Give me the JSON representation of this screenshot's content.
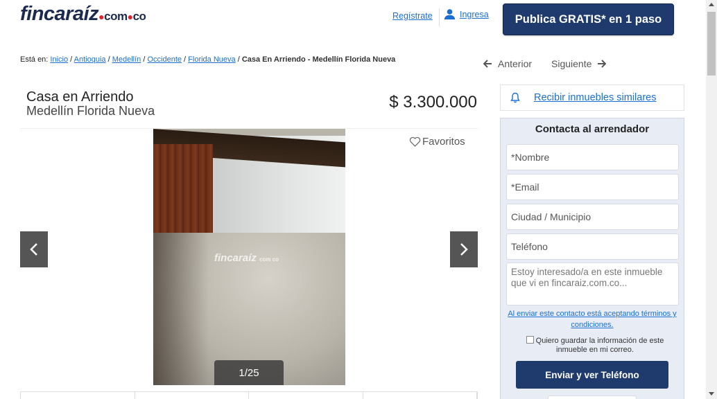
{
  "header": {
    "logo_main": "fincaraíz",
    "logo_suffix": "com",
    "logo_suffix2": "co",
    "register_label": "Regístrate",
    "login_label": "Ingresa",
    "publish_label": "Publica GRATIS* en 1 paso"
  },
  "breadcrumb": {
    "prefix": "Está en:",
    "items": [
      "Inicio",
      "Antioquia",
      "Medellín",
      "Occidente",
      "Florida Nueva"
    ],
    "current": "Casa En Arriendo - Medellín Florida Nueva"
  },
  "pager": {
    "prev_label": "Anterior",
    "next_label": "Siguiente"
  },
  "listing": {
    "title": "Casa en Arriendo",
    "location": "Medellín Florida Nueva",
    "price": "$ 3.300.000",
    "favorites_label": "Favoritos",
    "photo_counter": "1/25",
    "photo_watermark": "fincaraíz",
    "photo_watermark_suffix": "com co"
  },
  "similar": {
    "label": "Recibir inmuebles similares"
  },
  "contact": {
    "heading": "Contacta al arrendador",
    "name_placeholder": "*Nombre",
    "email_placeholder": "*Email",
    "city_placeholder": "Ciudad / Municipio",
    "phone_placeholder": "Teléfono",
    "message_placeholder": "Estoy interesado/a en este inmueble que vi en fincaraiz.com.co...",
    "terms_label": "Al enviar este contacto está aceptando términos y condiciones.",
    "save_info_label": "Quiero guardar la información de este inmueble en mi correo.",
    "send_label": "Enviar y ver Teléfono"
  },
  "colors": {
    "brand_navy": "#1f3b6e",
    "link_blue": "#1a6fd0",
    "logo_red": "#e4202d"
  }
}
